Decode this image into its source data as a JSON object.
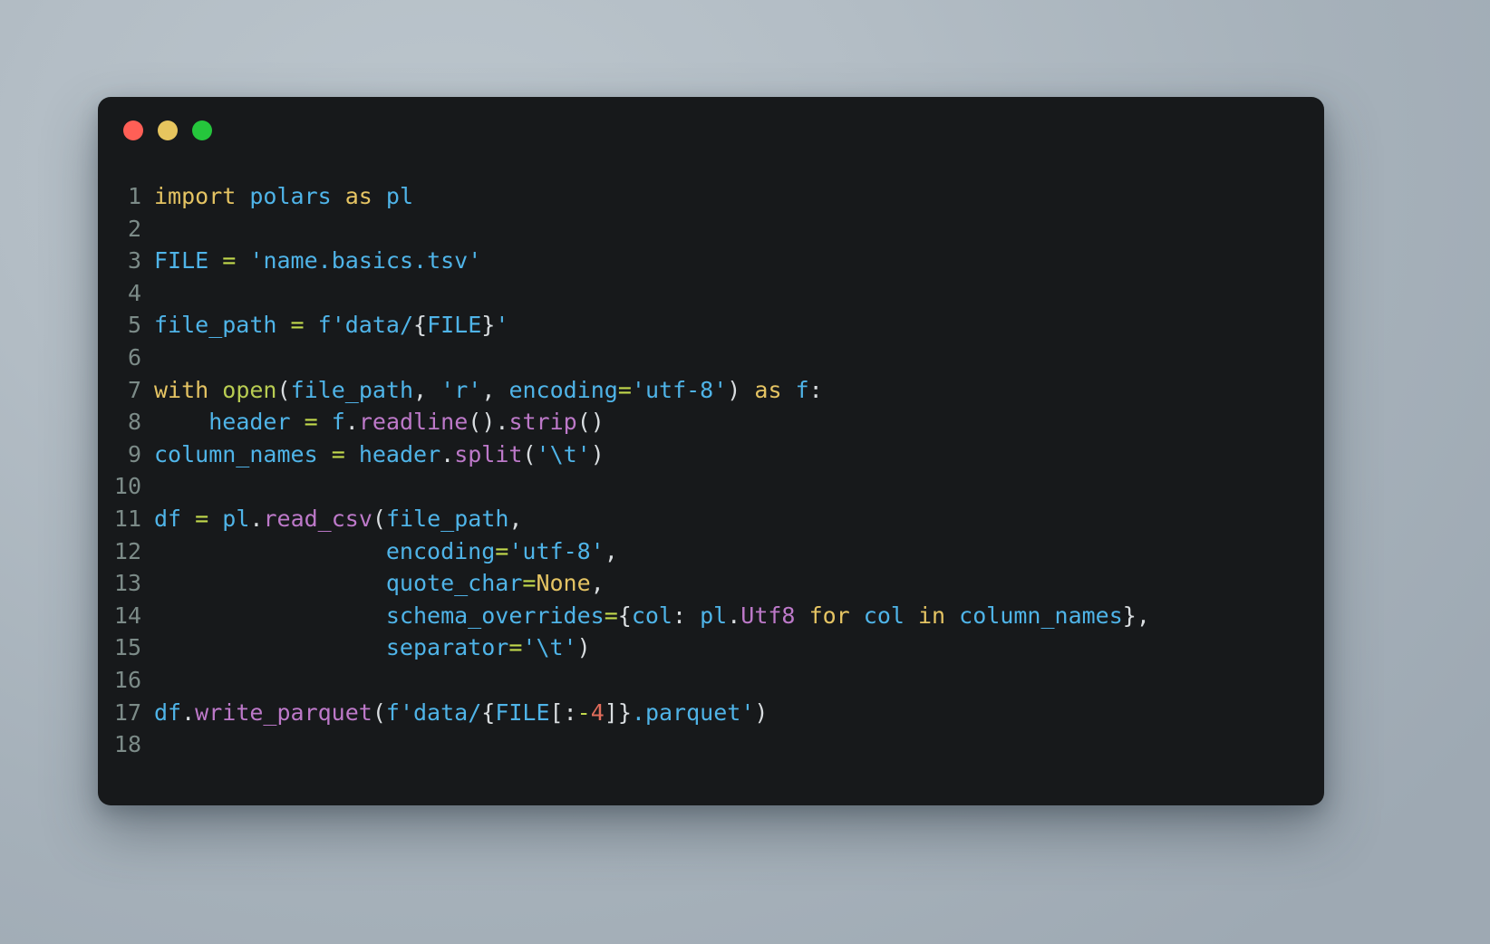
{
  "window": {
    "title_bar": {
      "buttons": [
        {
          "name": "close-button",
          "icon": "traffic-light-red",
          "color": "#ff5f56"
        },
        {
          "name": "minimize-button",
          "icon": "traffic-light-yellow",
          "color": "#e7c55e"
        },
        {
          "name": "maximize-button",
          "icon": "traffic-light-green",
          "color": "#25c63c"
        }
      ]
    },
    "background_color": "#17191b"
  },
  "theme": {
    "page_background": "#aeb8c0",
    "line_number_color": "#7c8b88",
    "keyword_color": "#e5c463",
    "builtin_color": "#b8cc52",
    "identifier_color": "#4fb4e8",
    "string_color": "#4fb4e8",
    "operator_color": "#c2d94c",
    "function_color": "#bd79c9",
    "punctuation_color": "#d9dde0",
    "number_color": "#e06c5b"
  },
  "editor": {
    "language": "python",
    "line_numbers": [
      "1",
      "2",
      "3",
      "4",
      "5",
      "6",
      "7",
      "8",
      "9",
      "10",
      "11",
      "12",
      "13",
      "14",
      "15",
      "16",
      "17",
      "18"
    ],
    "lines": [
      {
        "n": "1",
        "text": "import polars as pl"
      },
      {
        "n": "2",
        "text": ""
      },
      {
        "n": "3",
        "text": "FILE = 'name.basics.tsv'"
      },
      {
        "n": "4",
        "text": ""
      },
      {
        "n": "5",
        "text": "file_path = f'data/{FILE}'"
      },
      {
        "n": "6",
        "text": ""
      },
      {
        "n": "7",
        "text": "with open(file_path, 'r', encoding='utf-8') as f:"
      },
      {
        "n": "8",
        "text": "    header = f.readline().strip()"
      },
      {
        "n": "9",
        "text": "column_names = header.split('\\t')"
      },
      {
        "n": "10",
        "text": ""
      },
      {
        "n": "11",
        "text": "df = pl.read_csv(file_path,"
      },
      {
        "n": "12",
        "text": "                 encoding='utf-8',"
      },
      {
        "n": "13",
        "text": "                 quote_char=None,"
      },
      {
        "n": "14",
        "text": "                 schema_overrides={col: pl.Utf8 for col in column_names},"
      },
      {
        "n": "15",
        "text": "                 separator='\\t')"
      },
      {
        "n": "16",
        "text": ""
      },
      {
        "n": "17",
        "text": "df.write_parquet(f'data/{FILE[:-4]}.parquet')"
      },
      {
        "n": "18",
        "text": ""
      }
    ],
    "tokens": {
      "l1": [
        [
          "import",
          "kw"
        ],
        [
          " ",
          "plain"
        ],
        [
          "polars",
          "var"
        ],
        [
          " ",
          "plain"
        ],
        [
          "as",
          "kw"
        ],
        [
          " ",
          "plain"
        ],
        [
          "pl",
          "var"
        ]
      ],
      "l3": [
        [
          "FILE",
          "var"
        ],
        [
          " ",
          "plain"
        ],
        [
          "=",
          "op"
        ],
        [
          " ",
          "plain"
        ],
        [
          "'name.basics.tsv'",
          "str"
        ]
      ],
      "l5": [
        [
          "file_path",
          "var"
        ],
        [
          " ",
          "plain"
        ],
        [
          "=",
          "op"
        ],
        [
          " ",
          "plain"
        ],
        [
          "f'data/",
          "str"
        ],
        [
          "{",
          "punc"
        ],
        [
          "FILE",
          "var"
        ],
        [
          "}",
          "punc"
        ],
        [
          "'",
          "str"
        ]
      ],
      "l7": [
        [
          "with",
          "kw"
        ],
        [
          " ",
          "plain"
        ],
        [
          "open",
          "bi"
        ],
        [
          "(",
          "punc"
        ],
        [
          "file_path",
          "var"
        ],
        [
          ",",
          "punc"
        ],
        [
          " ",
          "plain"
        ],
        [
          "'r'",
          "str"
        ],
        [
          ",",
          "punc"
        ],
        [
          " ",
          "plain"
        ],
        [
          "encoding",
          "var"
        ],
        [
          "=",
          "op"
        ],
        [
          "'utf-8'",
          "str"
        ],
        [
          ")",
          "punc"
        ],
        [
          " ",
          "plain"
        ],
        [
          "as",
          "kw"
        ],
        [
          " ",
          "plain"
        ],
        [
          "f",
          "var"
        ],
        [
          ":",
          "punc"
        ]
      ],
      "l8": [
        [
          "    ",
          "plain"
        ],
        [
          "header",
          "var"
        ],
        [
          " ",
          "plain"
        ],
        [
          "=",
          "op"
        ],
        [
          " ",
          "plain"
        ],
        [
          "f",
          "var"
        ],
        [
          ".",
          "punc"
        ],
        [
          "readline",
          "fn"
        ],
        [
          "()",
          "punc"
        ],
        [
          ".",
          "punc"
        ],
        [
          "strip",
          "fn"
        ],
        [
          "()",
          "punc"
        ]
      ],
      "l9": [
        [
          "column_names",
          "var"
        ],
        [
          " ",
          "plain"
        ],
        [
          "=",
          "op"
        ],
        [
          " ",
          "plain"
        ],
        [
          "header",
          "var"
        ],
        [
          ".",
          "punc"
        ],
        [
          "split",
          "fn"
        ],
        [
          "(",
          "punc"
        ],
        [
          "'\\t'",
          "str"
        ],
        [
          ")",
          "punc"
        ]
      ],
      "l11": [
        [
          "df",
          "var"
        ],
        [
          " ",
          "plain"
        ],
        [
          "=",
          "op"
        ],
        [
          " ",
          "plain"
        ],
        [
          "pl",
          "var"
        ],
        [
          ".",
          "punc"
        ],
        [
          "read_csv",
          "fn"
        ],
        [
          "(",
          "punc"
        ],
        [
          "file_path",
          "var"
        ],
        [
          ",",
          "punc"
        ]
      ],
      "l12": [
        [
          "                 ",
          "plain"
        ],
        [
          "encoding",
          "var"
        ],
        [
          "=",
          "op"
        ],
        [
          "'utf-8'",
          "str"
        ],
        [
          ",",
          "punc"
        ]
      ],
      "l13": [
        [
          "                 ",
          "plain"
        ],
        [
          "quote_char",
          "var"
        ],
        [
          "=",
          "op"
        ],
        [
          "None",
          "kw"
        ],
        [
          ",",
          "punc"
        ]
      ],
      "l14": [
        [
          "                 ",
          "plain"
        ],
        [
          "schema_overrides",
          "var"
        ],
        [
          "=",
          "op"
        ],
        [
          "{",
          "punc"
        ],
        [
          "col",
          "var"
        ],
        [
          ":",
          "punc"
        ],
        [
          " ",
          "plain"
        ],
        [
          "pl",
          "var"
        ],
        [
          ".",
          "punc"
        ],
        [
          "Utf8",
          "fn"
        ],
        [
          " ",
          "plain"
        ],
        [
          "for",
          "kw"
        ],
        [
          " ",
          "plain"
        ],
        [
          "col",
          "var"
        ],
        [
          " ",
          "plain"
        ],
        [
          "in",
          "kw"
        ],
        [
          " ",
          "plain"
        ],
        [
          "column_names",
          "var"
        ],
        [
          "}",
          "punc"
        ],
        [
          ",",
          "punc"
        ]
      ],
      "l15": [
        [
          "                 ",
          "plain"
        ],
        [
          "separator",
          "var"
        ],
        [
          "=",
          "op"
        ],
        [
          "'\\t'",
          "str"
        ],
        [
          ")",
          "punc"
        ]
      ],
      "l17": [
        [
          "df",
          "var"
        ],
        [
          ".",
          "punc"
        ],
        [
          "write_parquet",
          "fn"
        ],
        [
          "(",
          "punc"
        ],
        [
          "f'data/",
          "str"
        ],
        [
          "{",
          "punc"
        ],
        [
          "FILE",
          "var"
        ],
        [
          "[:",
          "punc"
        ],
        [
          "-",
          "op"
        ],
        [
          "4",
          "num"
        ],
        [
          "]",
          "punc"
        ],
        [
          "}",
          "punc"
        ],
        [
          ".parquet'",
          "str"
        ],
        [
          ")",
          "punc"
        ]
      ]
    }
  }
}
